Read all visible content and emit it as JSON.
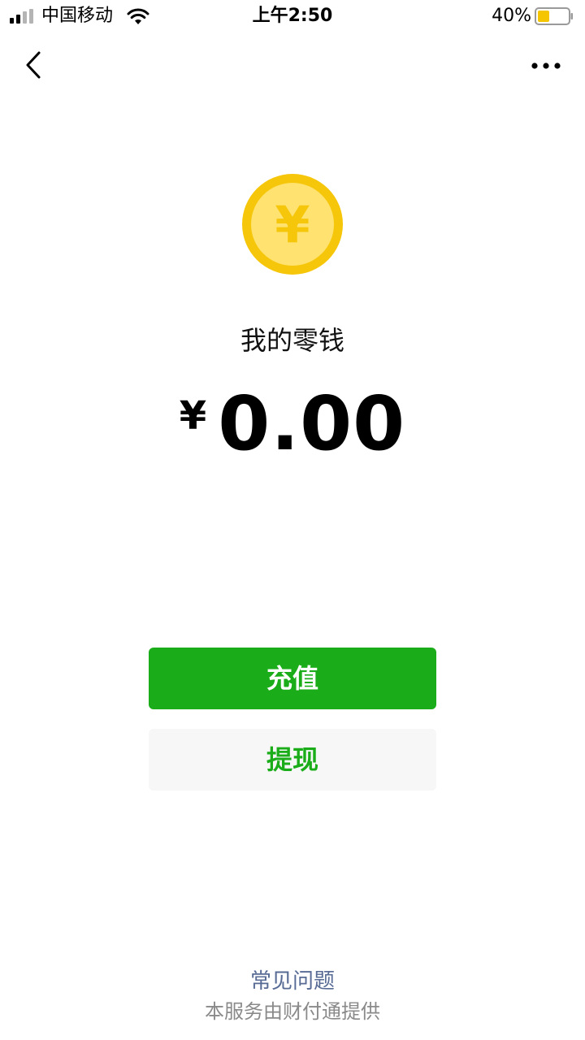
{
  "status_bar": {
    "carrier": "中国移动",
    "time": "上午2:50",
    "battery_percent": "40%",
    "battery_level": 0.4,
    "signal_bars_active": 2,
    "signal_bars_total": 4
  },
  "nav": {
    "back_icon": "chevron-left-icon",
    "more_icon": "more-dots-icon"
  },
  "wallet": {
    "coin_icon": "yuan-coin-icon",
    "coin_symbol": "¥",
    "title": "我的零钱",
    "currency_symbol": "¥",
    "balance": "0.00"
  },
  "actions": {
    "recharge_label": "充值",
    "withdraw_label": "提现"
  },
  "footer": {
    "faq_label": "常见问题",
    "provider_text": "本服务由财付通提供"
  },
  "colors": {
    "primary_green": "#1aad19",
    "secondary_button_bg": "#f7f7f7",
    "link_blue": "#576b95",
    "coin_outer": "#f6c60a",
    "coin_inner": "#ffe26f",
    "battery_fill": "#f5c500"
  }
}
